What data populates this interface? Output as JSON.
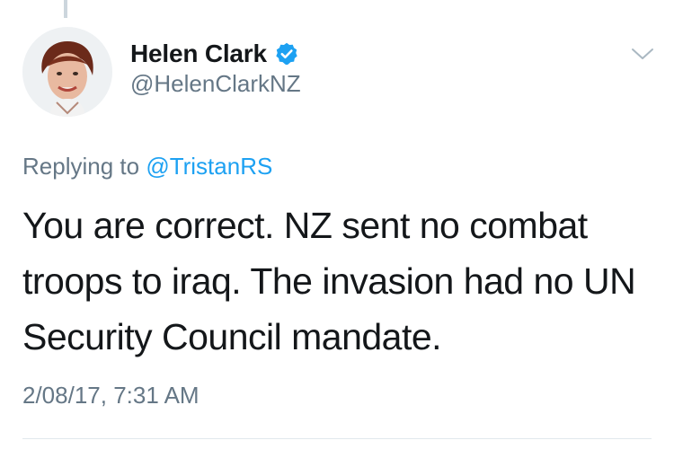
{
  "author": {
    "display_name": "Helen Clark",
    "handle": "@HelenClarkNZ",
    "verified": true,
    "verified_icon": "verified-badge-icon"
  },
  "reply": {
    "prefix": "Replying to",
    "mention": "@TristanRS"
  },
  "tweet": {
    "text": "You are correct. NZ sent no combat troops to iraq. The invasion had no UN Security Council mandate.",
    "timestamp": "2/08/17, 7:31 AM"
  },
  "icons": {
    "menu": "chevron-down-icon",
    "avatar": "avatar"
  },
  "colors": {
    "accent": "#1da1f2",
    "secondary_text": "#657786",
    "primary_text": "#14171a",
    "divider": "#e1e8ed"
  }
}
